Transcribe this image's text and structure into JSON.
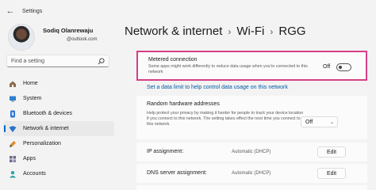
{
  "window": {
    "title": "Settings",
    "back_icon": "back-arrow-icon"
  },
  "profile": {
    "name": "Sodiq Olanrewaju",
    "email": "@outlook.com"
  },
  "search": {
    "placeholder": "Find a setting",
    "icon": "search-icon"
  },
  "nav": {
    "items": [
      {
        "label": "Home",
        "icon": "home-icon",
        "active": false
      },
      {
        "label": "System",
        "icon": "system-icon",
        "active": false
      },
      {
        "label": "Bluetooth & devices",
        "icon": "bluetooth-icon",
        "active": false
      },
      {
        "label": "Network & internet",
        "icon": "wifi-icon",
        "active": true
      },
      {
        "label": "Personalization",
        "icon": "brush-icon",
        "active": false
      },
      {
        "label": "Apps",
        "icon": "apps-icon",
        "active": false
      },
      {
        "label": "Accounts",
        "icon": "accounts-icon",
        "active": false
      }
    ]
  },
  "breadcrumb": {
    "part1": "Network & internet",
    "sep1": "›",
    "part2": "Wi-Fi",
    "sep2": "›",
    "part3": "RGG"
  },
  "metered": {
    "title": "Metered connection",
    "description": "Some apps might work differently to reduce data usage when you're connected to this network",
    "toggle_label": "Off",
    "toggle_on": false
  },
  "data_limit_link": "Set a data limit to help control data usage on this network",
  "random_hw": {
    "title": "Random hardware addresses",
    "description": "Help protect your privacy by making it harder for people to track your device location if you connect to this network. The setting takes effect the next time you connect to this network.",
    "value": "Off"
  },
  "ip": {
    "label": "IP assignment:",
    "value": "Automatic (DHCP)",
    "button": "Edit"
  },
  "dns": {
    "label": "DNS server assignment:",
    "value": "Automatic (DHCP)",
    "button": "Edit"
  },
  "colors": {
    "accent": "#0067c0",
    "highlight_border": "#d63f86",
    "link": "#0058a8"
  }
}
